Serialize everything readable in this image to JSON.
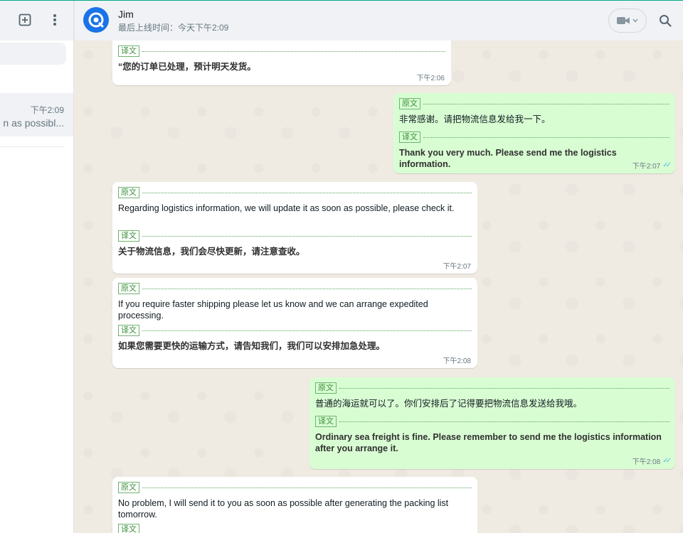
{
  "sidebar": {
    "chat_item": {
      "time": "下午2:09",
      "preview": "n as possibl..."
    }
  },
  "header": {
    "contact_name": "Jim",
    "status": "最后上线时间：今天下午2:09"
  },
  "labels": {
    "original": "原文",
    "translation": "译文"
  },
  "messages": [
    {
      "direction": "in",
      "translation": "“您的订单已处理，预计明天发货。",
      "time": "下午2:06"
    },
    {
      "direction": "out",
      "original": "非常感谢。请把物流信息发给我一下。",
      "translation": "Thank you very much. Please send me the logistics information.",
      "time": "下午2:07",
      "read": true
    },
    {
      "direction": "in",
      "original": "Regarding logistics information, we will update it as soon as possible, please check it.",
      "translation": "关于物流信息，我们会尽快更新，请注意查收。",
      "time": "下午2:07"
    },
    {
      "direction": "in",
      "original": "If you require faster shipping please let us know and we can arrange expedited processing.",
      "translation": "如果您需要更快的运输方式，请告知我们，我们可以安排加急处理。",
      "time": "下午2:08"
    },
    {
      "direction": "out",
      "original": "普通的海运就可以了。你们安排后了记得要把物流信息发送给我哦。",
      "translation": "Ordinary sea freight is fine. Please remember to send me the logistics information after you arrange it.",
      "time": "下午2:08",
      "read": true
    },
    {
      "direction": "in",
      "original": "No problem, I will send it to you as soon as possible after generating the packing list tomorrow."
    }
  ],
  "colors": {
    "accent": "#00a884",
    "outgoing_bubble": "#d9fdd3",
    "incoming_bubble": "#ffffff",
    "chat_background": "#efeae2",
    "tag_green": "#3b8d3b",
    "read_ticks": "#53bdeb"
  },
  "icons": [
    "new-chat-icon",
    "menu-icon",
    "avatar-logo-icon",
    "video-call-icon",
    "chevron-down-icon",
    "search-icon",
    "double-check-icon"
  ]
}
